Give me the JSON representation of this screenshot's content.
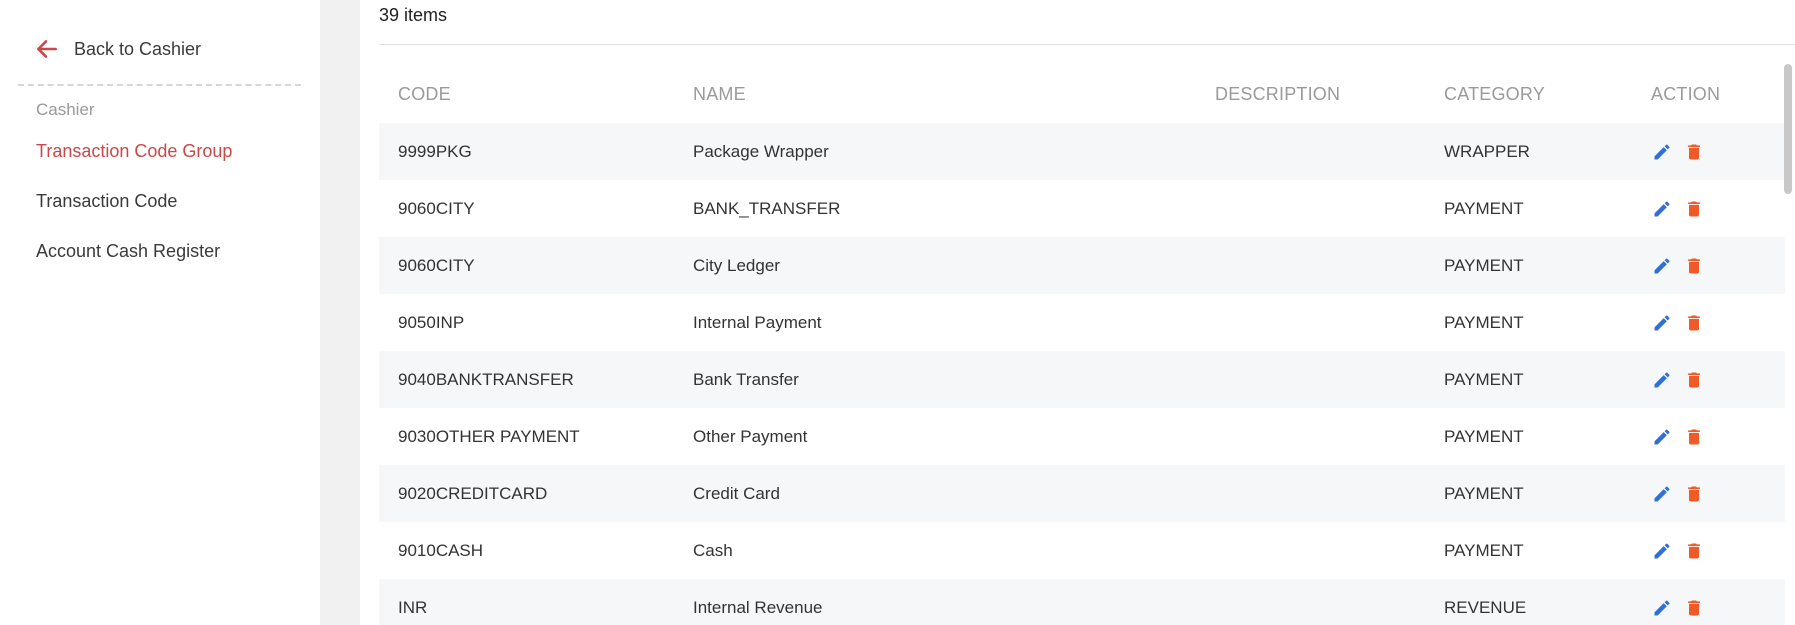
{
  "sidebar": {
    "back_label": "Back to Cashier",
    "section_label": "Cashier",
    "items": [
      {
        "label": "Transaction Code Group",
        "active": true
      },
      {
        "label": "Transaction Code",
        "active": false
      },
      {
        "label": "Account Cash Register",
        "active": false
      }
    ]
  },
  "main": {
    "items_count": "39 items",
    "columns": {
      "code": "CODE",
      "name": "NAME",
      "description": "DESCRIPTION",
      "category": "CATEGORY",
      "action": "ACTION"
    },
    "rows": [
      {
        "code": "9999PKG",
        "name": "Package Wrapper",
        "description": "",
        "category": "WRAPPER"
      },
      {
        "code": "9060CITY",
        "name": "BANK_TRANSFER",
        "description": "",
        "category": "PAYMENT"
      },
      {
        "code": "9060CITY",
        "name": "City Ledger",
        "description": "",
        "category": "PAYMENT"
      },
      {
        "code": "9050INP",
        "name": "Internal Payment",
        "description": "",
        "category": "PAYMENT"
      },
      {
        "code": "9040BANKTRANSFER",
        "name": "Bank Transfer",
        "description": "",
        "category": "PAYMENT"
      },
      {
        "code": "9030OTHER PAYMENT",
        "name": "Other Payment",
        "description": "",
        "category": "PAYMENT"
      },
      {
        "code": "9020CREDITCARD",
        "name": "Credit Card",
        "description": "",
        "category": "PAYMENT"
      },
      {
        "code": "9010CASH",
        "name": "Cash",
        "description": "",
        "category": "PAYMENT"
      },
      {
        "code": "INR",
        "name": "Internal Revenue",
        "description": "",
        "category": "REVENUE"
      }
    ]
  },
  "colors": {
    "accent": "#c94848",
    "edit_icon": "#2f6fd6",
    "delete_icon": "#f05a28",
    "row_stripe": "#f6f7f9"
  },
  "icons": {
    "back": "arrow-left-icon",
    "edit": "pencil-icon",
    "delete": "trash-icon"
  }
}
